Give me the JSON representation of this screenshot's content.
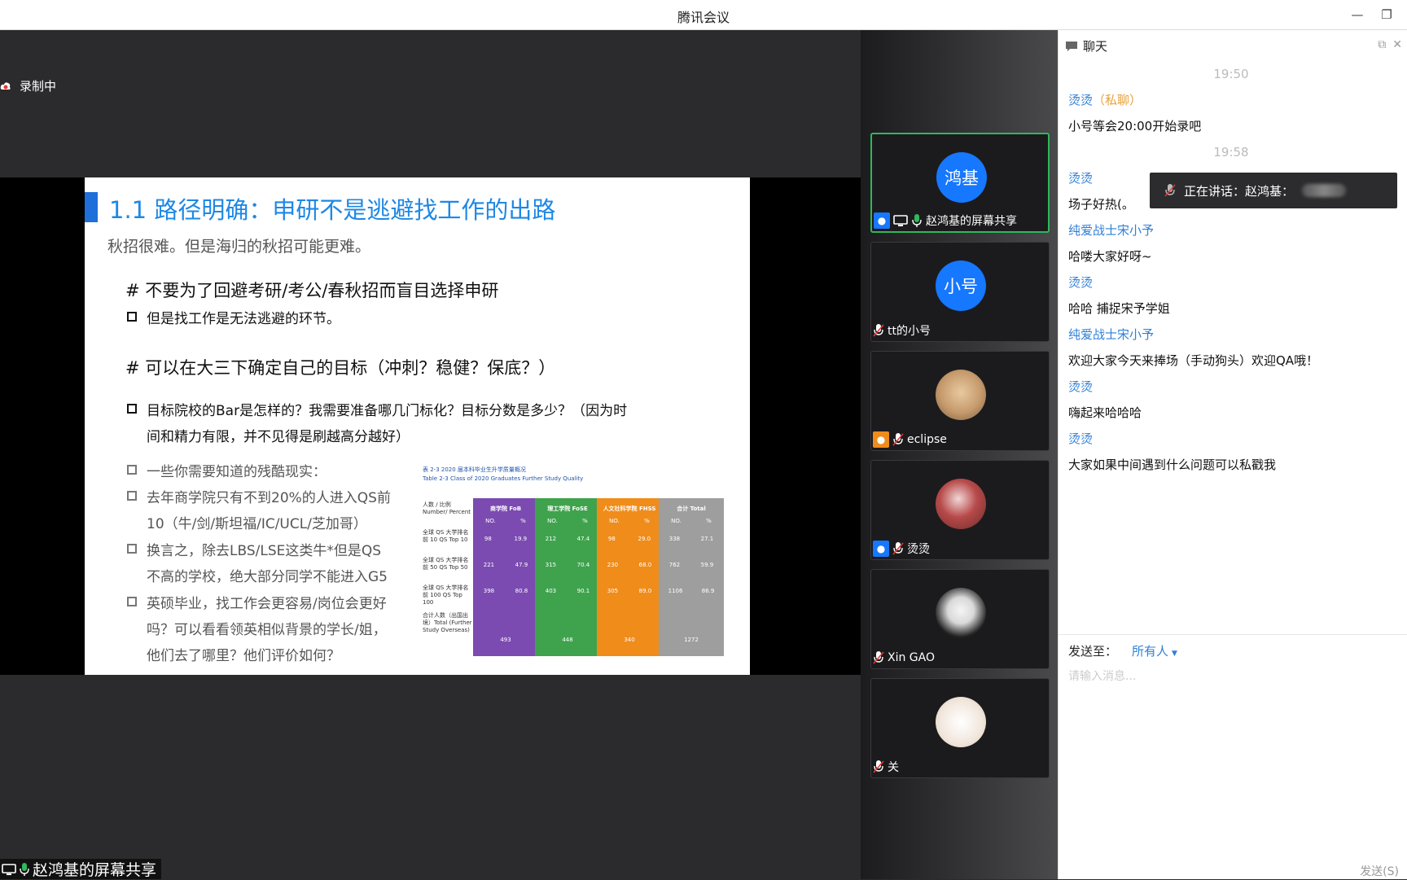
{
  "app": {
    "title": "腾讯会议"
  },
  "window": {
    "minimize": "—",
    "restore": "❐"
  },
  "recording": {
    "label": "录制中"
  },
  "slide": {
    "heading": "1.1 路径明确：申研不是逃避找工作的出路",
    "subtitle": "秋招很难。但是海归的秋招可能更难。",
    "section1": "# 不要为了回避考研/考公/春秋招而盲目选择申研",
    "bullet1": "但是找工作是无法逃避的环节。",
    "section2": "# 可以在大三下确定自己的目标（冲刺？稳健？保底？）",
    "bullet2_line1": "目标院校的Bar是怎样的？我需要准备哪几门标化？目标分数是多少？（因为时",
    "bullet2_line2": "间和精力有限，并不见得是刷越高分越好）",
    "bullet3": "一些你需要知道的残酷现实：",
    "bullet4_line1": "去年商学院只有不到20%的人进入QS前",
    "bullet4_line2": "10（牛/剑/斯坦福/IC/UCL/芝加哥）",
    "bullet5_line1": "换言之，除去LBS/LSE这类牛*但是QS",
    "bullet5_line2": "不高的学校，绝大部分同学不能进入G5",
    "bullet6_line1": "英硕毕业，找工作会更容易/岗位会更好",
    "bullet6_line2": "吗？可以看看领英相似背景的学长/姐，",
    "bullet6_line3": "他们去了哪里？他们评价如何？",
    "table": {
      "title_cn": "表 2-3 2020 届本科毕业生升学质量概况",
      "title_en": "Table 2-3 Class of 2020 Graduates Further Study Quality",
      "row_header": "人数 / 比例 Number/ Percent",
      "rows": [
        "全球 QS 大学排名前 10 QS Top 10",
        "全球 QS 大学排名前 50 QS Top 50",
        "全球 QS 大学排名前 100 QS Top 100",
        "合计人数（出国出境）Total (Further Study Overseas)"
      ],
      "columns": [
        {
          "name": "商学院 FoB",
          "color": "#7b4bb1",
          "sub": [
            "NO.",
            "%"
          ],
          "cells": [
            [
              "98",
              "19.9"
            ],
            [
              "221",
              "47.9"
            ],
            [
              "398",
              "80.8"
            ]
          ],
          "total": "493"
        },
        {
          "name": "理工学院 FoSE",
          "color": "#3fa34d",
          "sub": [
            "NO.",
            "%"
          ],
          "cells": [
            [
              "212",
              "47.4"
            ],
            [
              "315",
              "70.4"
            ],
            [
              "403",
              "90.1"
            ]
          ],
          "total": "448"
        },
        {
          "name": "人文社科学院 FHSS",
          "color": "#f08c1a",
          "sub": [
            "NO.",
            "%"
          ],
          "cells": [
            [
              "98",
              "29.0"
            ],
            [
              "230",
              "68.0"
            ],
            [
              "305",
              "89.0"
            ]
          ],
          "total": "340"
        },
        {
          "name": "合计 Total",
          "color": "#9e9e9e",
          "sub": [
            "NO.",
            "%"
          ],
          "cells": [
            [
              "338",
              "27.1"
            ],
            [
              "762",
              "59.9"
            ],
            [
              "1106",
              "86.9"
            ]
          ],
          "total": "1272"
        }
      ]
    }
  },
  "share_label": "赵鸿基的屏幕共享",
  "participants": [
    {
      "avatar_text": "鸿基",
      "name": "赵鸿基的屏幕共享",
      "active": true
    },
    {
      "avatar_text": "小号",
      "name": "tt的小号"
    },
    {
      "avatar_text": "",
      "name": "eclipse"
    },
    {
      "avatar_text": "",
      "name": "烫烫"
    },
    {
      "avatar_text": "",
      "name": "Xin GAO"
    },
    {
      "avatar_text": "",
      "name": "关"
    }
  ],
  "chat": {
    "header": "聊天",
    "messages": [
      {
        "time": "19:50"
      },
      {
        "sender": "烫烫",
        "private": "（私聊）",
        "text": "小号等会20:00开始录吧"
      },
      {
        "time": "19:58"
      },
      {
        "sender": "烫烫",
        "text": "场子好热(。"
      },
      {
        "sender": "纯爱战士宋小予",
        "text": "哈喽大家好呀~"
      },
      {
        "sender": "烫烫",
        "text": "哈哈 捕捉宋予学姐"
      },
      {
        "sender": "纯爱战士宋小予",
        "text": "欢迎大家今天来捧场（手动狗头）欢迎QA哦！"
      },
      {
        "sender": "烫烫",
        "text": "嗨起来哈哈哈"
      },
      {
        "sender": "烫烫",
        "text": "大家如果中间遇到什么问题可以私戳我"
      }
    ],
    "speaking_label": "正在讲话：赵鸿基：",
    "send_to_label": "发送至：",
    "send_to_target": "所有人",
    "input_placeholder": "请输入消息...",
    "send_button": "发送(S)"
  }
}
